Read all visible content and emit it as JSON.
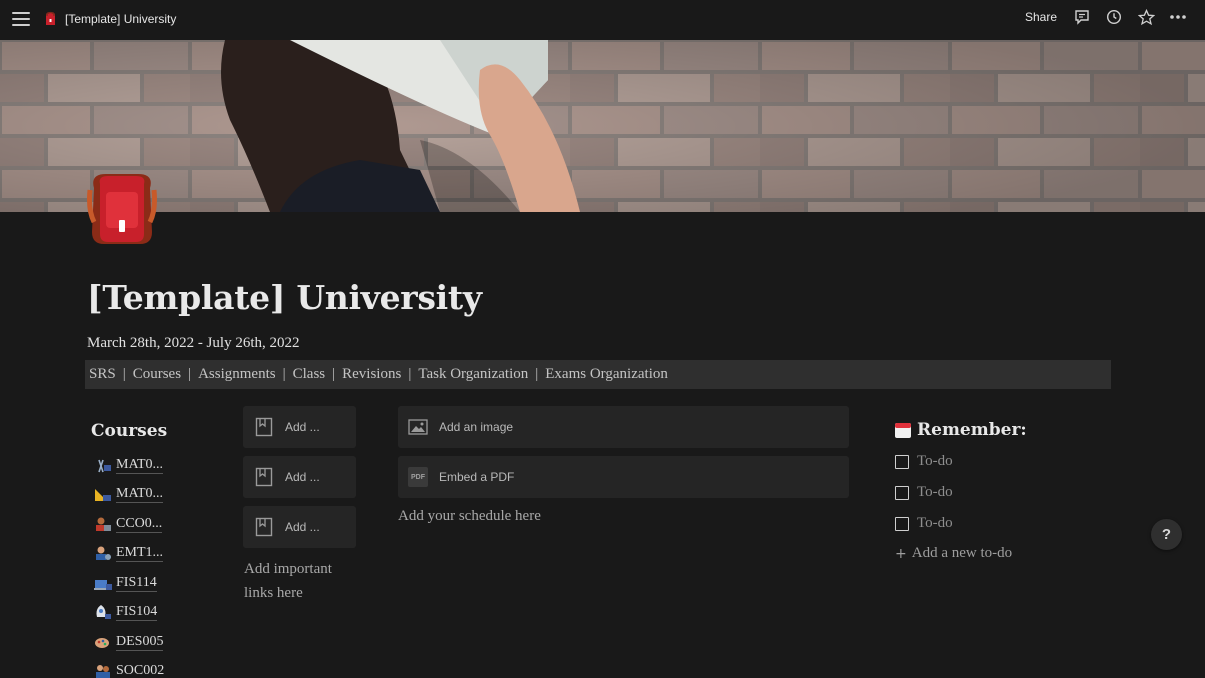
{
  "topbar": {
    "breadcrumb": "[Template] University",
    "share_label": "Share",
    "icons": [
      "menu-icon",
      "comment-icon",
      "clock-icon",
      "star-icon",
      "more-icon"
    ]
  },
  "page": {
    "title": "[Template] University",
    "dates": "March 28th, 2022 - July 26th, 2022",
    "icon": "backpack-icon"
  },
  "nav": {
    "links": [
      "SRS",
      "Courses",
      "Assignments",
      "Class",
      "Revisions",
      "Task Organization",
      "Exams Organization"
    ],
    "separator": "|"
  },
  "courses": {
    "heading": "Courses",
    "items": [
      {
        "label": "MAT0...",
        "icon": "compass-icon"
      },
      {
        "label": "MAT0...",
        "icon": "ruler-triangle-icon"
      },
      {
        "label": "CCO0...",
        "icon": "person-computer-icon"
      },
      {
        "label": "EMT1...",
        "icon": "person-gear-icon"
      },
      {
        "label": "FIS114",
        "icon": "laptop-icon"
      },
      {
        "label": "FIS104",
        "icon": "rocket-icon"
      },
      {
        "label": "DES005",
        "icon": "palette-icon"
      },
      {
        "label": "SOC002",
        "icon": "people-icon"
      }
    ]
  },
  "links": {
    "cards": [
      "Add ...",
      "Add ...",
      "Add ..."
    ],
    "note": "Add important links here"
  },
  "media": {
    "image_label": "Add an image",
    "pdf_label": "Embed a PDF",
    "pdf_badge": "PDF",
    "schedule_note": "Add your schedule here"
  },
  "remember": {
    "heading": "Remember:",
    "todos": [
      "To-do",
      "To-do",
      "To-do"
    ],
    "add_label": "Add a new to-do"
  },
  "help": {
    "label": "?"
  },
  "colors": {
    "background": "#191919",
    "card": "#252525",
    "navbar": "#2f2f2f",
    "accent_red": "#c8202b"
  }
}
